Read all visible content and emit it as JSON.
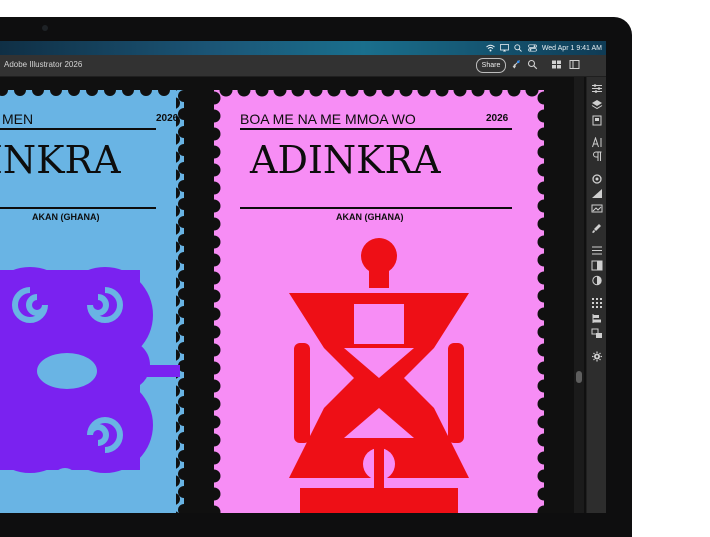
{
  "menubar": {
    "datetime": "Wed Apr 1  9:41 AM",
    "icons": [
      "wifi-icon",
      "screen-mirror-icon",
      "search-icon",
      "control-center-icon"
    ]
  },
  "titlebar": {
    "app_title": "Adobe Illustrator 2026",
    "share_label": "Share",
    "icons": [
      "rocket-icon",
      "search-icon",
      "workspace-grid-icon",
      "panel-toggle-icon"
    ]
  },
  "stamps": [
    {
      "header": "MEN",
      "year": "2026",
      "logo": "ADINKRA",
      "origin": "AKAN (GHANA)",
      "background": "#69b4e4",
      "symbol_color": "#7a22f0"
    },
    {
      "header": "BOA ME NA ME MMOA WO",
      "year": "2026",
      "logo": "ADINKRA",
      "origin": "AKAN (GHANA)",
      "background": "#f78df5",
      "symbol_color": "#ee0f16"
    }
  ],
  "right_panel": {
    "icons": [
      "properties-icon",
      "layers-icon",
      "libraries-icon",
      "character-icon",
      "paragraph-icon",
      "appearance-icon",
      "gradient-icon",
      "image-trace-icon",
      "brushes-icon",
      "align-icon",
      "pathfinder-icon",
      "color-icon",
      "transform-icon",
      "symbols-icon",
      "links-icon",
      "artboards-icon",
      "settings-icon"
    ]
  }
}
